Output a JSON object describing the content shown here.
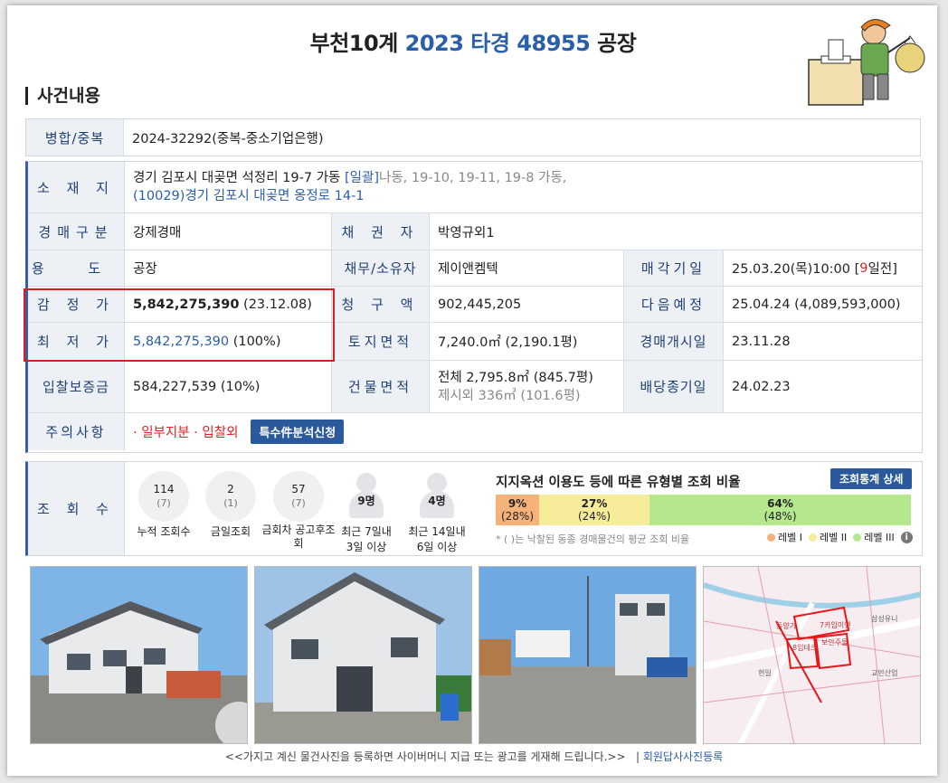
{
  "header": {
    "prefix": "부천10계",
    "case_no": "2023 타경 48955",
    "type": "공장"
  },
  "section_title": "사건내용",
  "merge": {
    "label": "병합/중복",
    "value": "2024-32292(중복-중소기업은행)"
  },
  "location": {
    "label": "소 재 지",
    "address_main": "경기 김포시 대곶면 석정리 19-7 가동",
    "bulk_tag": "[일괄]",
    "bulk_rest": "나동, 19-10, 19-11, 19-8 가동,",
    "road_address": "(10029)경기 김포시  대곶면 옹정로  14-1"
  },
  "rows": {
    "auction_type": {
      "label": "경매구분",
      "value": "강제경매"
    },
    "creditor": {
      "label": "채 권 자",
      "value": "박영규외1"
    },
    "usage": {
      "label": "용  도",
      "value": "공장"
    },
    "debtor": {
      "label": "채무/소유자",
      "value": "제이앤켐텍"
    },
    "sale_date": {
      "label": "매각기일",
      "value": "25.03.20(목)10:00 [",
      "days": "9",
      "suffix": "일전]"
    },
    "appraisal": {
      "label": "감 정 가",
      "amount": "5,842,275,390",
      "note": "(23.12.08)"
    },
    "claim": {
      "label": "청 구 액",
      "value": "902,445,205"
    },
    "next": {
      "label": "다음예정",
      "value": "25.04.24 (4,089,593,000)"
    },
    "minimum": {
      "label": "최 저 가",
      "amount": "5,842,275,390",
      "note": "(100%)"
    },
    "land_area": {
      "label": "토지면적",
      "value": "7,240.0㎡ (2,190.1평)"
    },
    "auction_start": {
      "label": "경매개시일",
      "value": "23.11.28"
    },
    "deposit": {
      "label": "입찰보증금",
      "value": "584,227,539 (10%)"
    },
    "building_area": {
      "label": "건물면적",
      "value1": "전체 2,795.8㎡ (845.7평)",
      "value2": "제시외 336㎡ (101.6평)"
    },
    "dividend": {
      "label": "배당종기일",
      "value": "24.02.23"
    },
    "caution": {
      "label": "주의사항",
      "value": "· 일부지분 · 입찰외",
      "button": "특수件분석신청"
    }
  },
  "views": {
    "label": "조 회 수",
    "stats": [
      {
        "num": "114",
        "sub": "(7)",
        "caption": "누적 조회수"
      },
      {
        "num": "2",
        "sub": "(1)",
        "caption": "금일조회"
      },
      {
        "num": "57",
        "sub": "(7)",
        "caption": "금회차 공고후조회"
      }
    ],
    "people": [
      {
        "num": "9명",
        "line1": "최근 7일내",
        "line2": "3일 이상"
      },
      {
        "num": "4명",
        "line1": "최근 14일내",
        "line2": "6일 이상"
      }
    ],
    "ratio_title": "지지옥션 이용도 등에 따른 유형별 조회 비율",
    "stat_button": "조회통계 상세",
    "bars": [
      {
        "pct": "9%",
        "sub": "(28%)",
        "color": "#f5b27a"
      },
      {
        "pct": "27%",
        "sub": "(24%)",
        "color": "#f7ec9a"
      },
      {
        "pct": "64%",
        "sub": "(48%)",
        "color": "#b5e88e"
      }
    ],
    "note": "* ( )는 낙찰된 동종 경매물건의 평균 조회 비율",
    "legend": [
      "레벨 I",
      "레벨 II",
      "레벨 III"
    ]
  },
  "footer": {
    "text": "<<가지고 계신 물건사진을 등록하면 사이버머니 지급 또는 광고를 게재해 드립니다.>>",
    "link": "회원답사사진등록"
  },
  "map_labels": [
    "동양기",
    "7카임이엔",
    "8임테크",
    "보안주물",
    "삼성유니",
    "현일",
    "교반산업"
  ]
}
